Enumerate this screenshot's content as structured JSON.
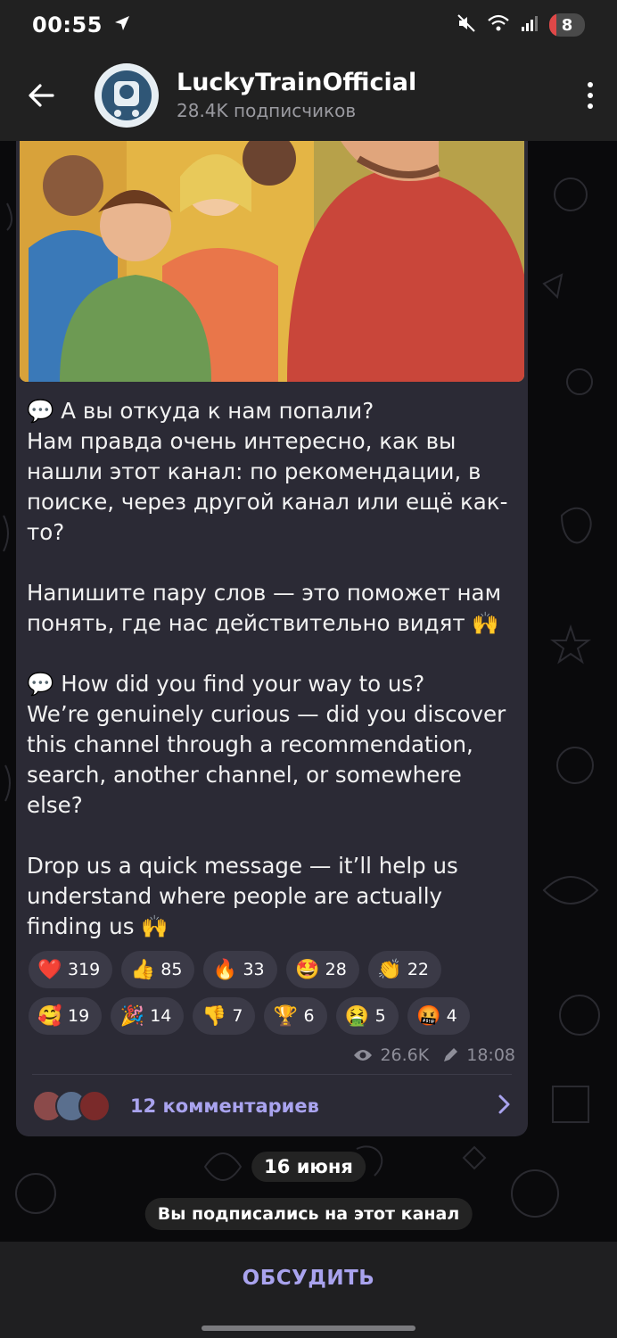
{
  "status_bar": {
    "time": "00:55",
    "battery": "8"
  },
  "header": {
    "channel_name": "LuckyTrainOfficial",
    "subscribers": "28.4K подписчиков"
  },
  "message": {
    "paragraphs": [
      "💬 А вы откуда к нам попали?\nНам правда очень интересно, как вы нашли этот канал: по рекомендации, в поиске, через другой канал или ещё как-то?",
      "Напишите пару слов — это поможет нам понять, где нас действительно видят 🙌",
      "💬 How did you find your way to us?\nWe’re genuinely curious — did you discover this channel through a recommendation, search, another channel, or somewhere else?",
      "Drop us a quick message — it’ll help us understand where people are actually finding us 🙌"
    ],
    "reactions_row1": [
      {
        "emoji": "❤️",
        "count": "319"
      },
      {
        "emoji": "👍",
        "count": "85"
      },
      {
        "emoji": "🔥",
        "count": "33"
      },
      {
        "emoji": "🤩",
        "count": "28"
      },
      {
        "emoji": "👏",
        "count": "22"
      }
    ],
    "reactions_row2": [
      {
        "emoji": "🥰",
        "count": "19"
      },
      {
        "emoji": "🎉",
        "count": "14"
      },
      {
        "emoji": "👎",
        "count": "7"
      },
      {
        "emoji": "🏆",
        "count": "6"
      },
      {
        "emoji": "🤮",
        "count": "5"
      },
      {
        "emoji": "🤬",
        "count": "4"
      }
    ],
    "views": "26.6K",
    "time": "18:08",
    "comments_label": "12 комментариев"
  },
  "date_pill": "16 июня",
  "system_message": "Вы подписались на этот канал",
  "discuss_button": "ОБСУДИТЬ",
  "colors": {
    "accent": "#a9a3ee",
    "bubble": "#2b2a35",
    "reaction_chip": "#3b3a47"
  }
}
